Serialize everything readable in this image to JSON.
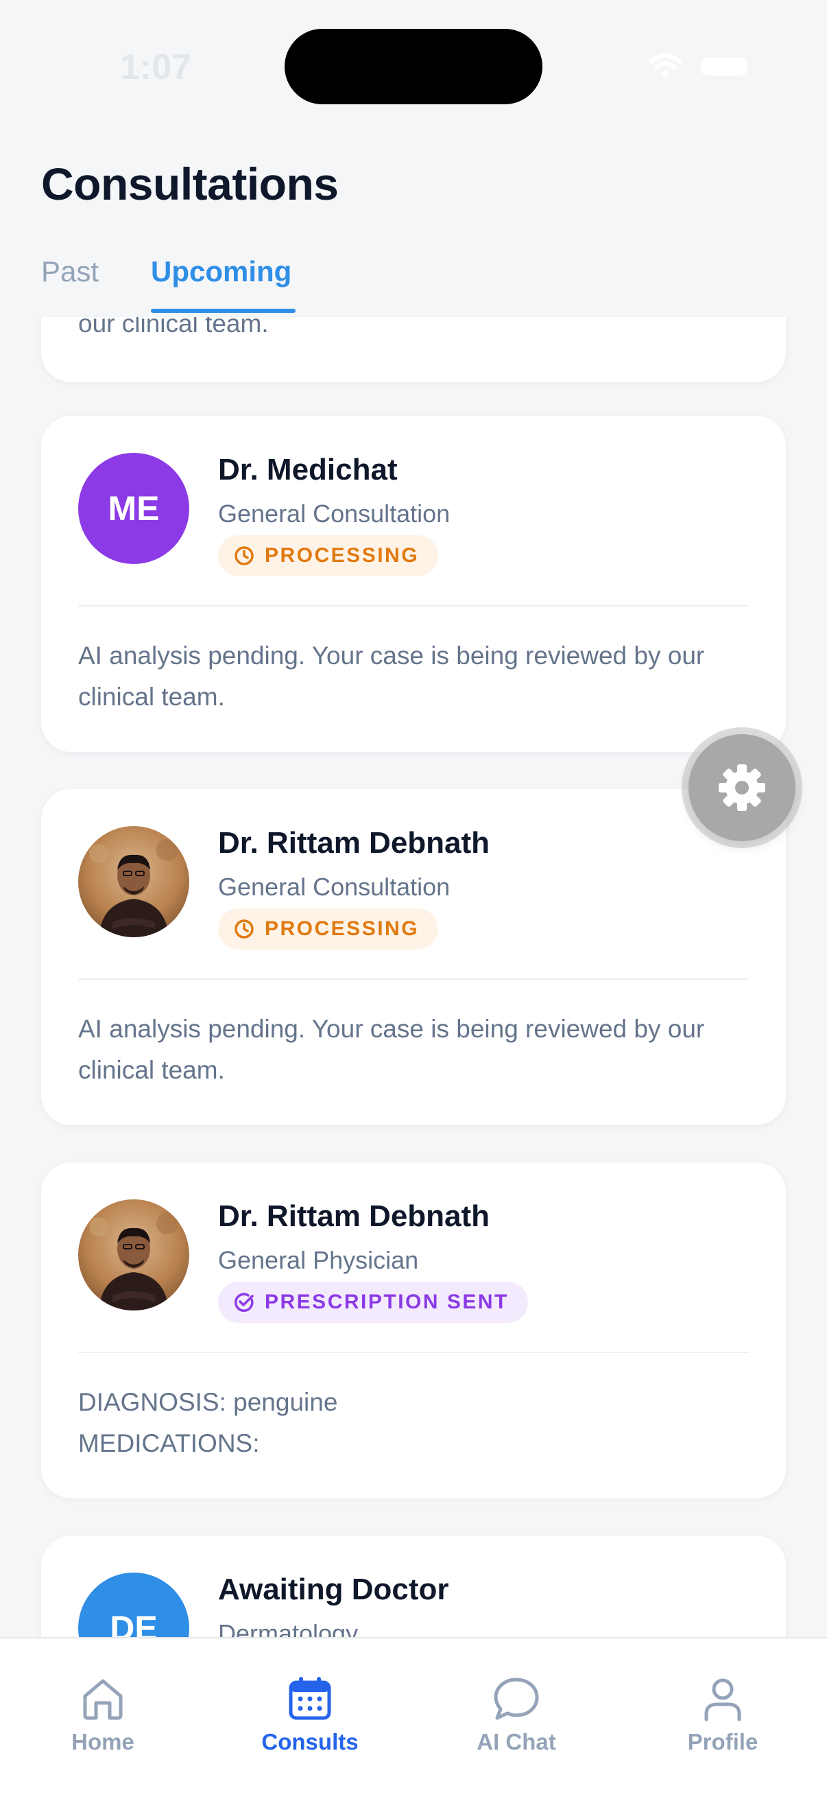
{
  "status_bar": {
    "time": "1:07"
  },
  "header": {
    "title": "Consultations",
    "tabs": [
      {
        "label": "Past",
        "active": false
      },
      {
        "label": "Upcoming",
        "active": true
      }
    ]
  },
  "consultations": [
    {
      "note": "our clinical team."
    },
    {
      "avatar_initials": "ME",
      "avatar_color": "#8b3ae6",
      "doctor": "Dr. Medichat",
      "specialty": "General Consultation",
      "status": "PROCESSING",
      "status_icon": "clock-icon",
      "note": "AI analysis pending. Your case is being reviewed by our clinical team."
    },
    {
      "avatar_photo": true,
      "doctor": "Dr. Rittam Debnath",
      "specialty": "General Consultation",
      "status": "PROCESSING",
      "status_icon": "clock-icon",
      "note": "AI analysis pending. Your case is being reviewed by our clinical team."
    },
    {
      "avatar_photo": true,
      "doctor": "Dr. Rittam Debnath",
      "specialty": "General Physician",
      "status": "PRESCRIPTION SENT",
      "status_icon": "check-circle-icon",
      "note_line1": "DIAGNOSIS: penguine",
      "note_line2": "MEDICATIONS:"
    },
    {
      "avatar_initials": "DE",
      "avatar_color": "#2f8ee6",
      "doctor": "Awaiting Doctor",
      "specialty": "Dermatology"
    }
  ],
  "fab": {
    "icon": "gear-icon"
  },
  "bottom_nav": [
    {
      "label": "Home",
      "icon": "home-icon",
      "active": false
    },
    {
      "label": "Consults",
      "icon": "calendar-icon",
      "active": true
    },
    {
      "label": "AI Chat",
      "icon": "chat-bubble-icon",
      "active": false
    },
    {
      "label": "Profile",
      "icon": "person-icon",
      "active": false
    }
  ],
  "colors": {
    "accent": "#2f8ee6",
    "nav_active": "#2563eb",
    "processing": "#e07a10",
    "prescription": "#8b3ae6"
  }
}
